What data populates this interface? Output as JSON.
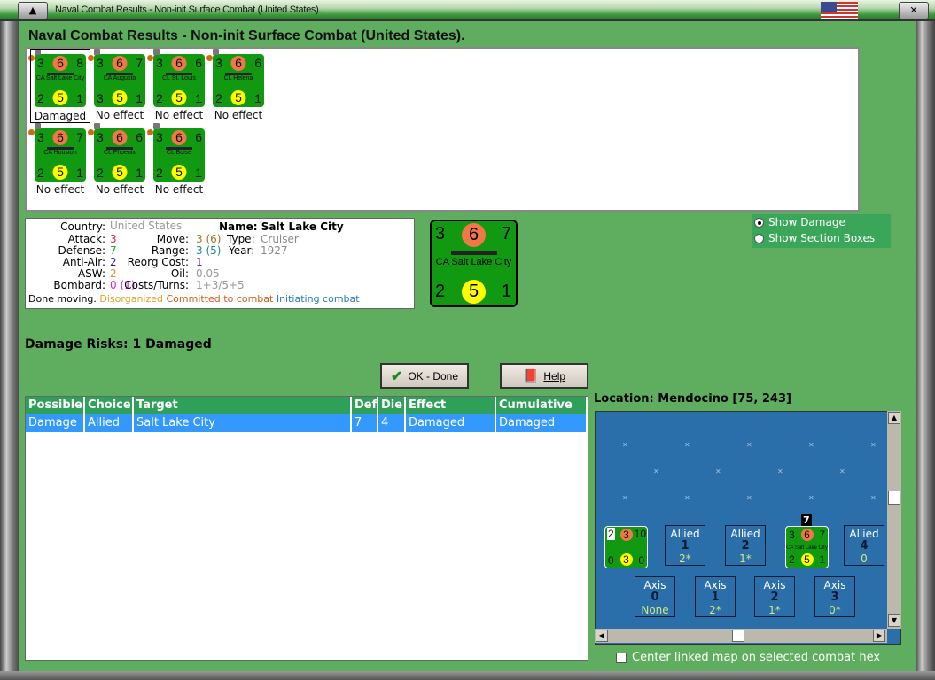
{
  "window": {
    "title": "Naval Combat Results - Non-init Surface Combat (United States).",
    "heading": "Naval Combat Results - Non-init Surface Combat (United States)."
  },
  "units": [
    {
      "name": "CA Salt Lake City",
      "att": "3",
      "mid": "6",
      "def": "8",
      "aa": "2",
      "move": "5",
      "range": "1",
      "result": "Damaged",
      "selected": true
    },
    {
      "name": "CA Augusta",
      "att": "3",
      "mid": "6",
      "def": "7",
      "aa": "3",
      "move": "5",
      "range": "1",
      "result": "No effect"
    },
    {
      "name": "CL St. Louis",
      "att": "3",
      "mid": "6",
      "def": "6",
      "aa": "2",
      "move": "5",
      "range": "1",
      "result": "No effect"
    },
    {
      "name": "CL Helena",
      "att": "3",
      "mid": "6",
      "def": "6",
      "aa": "2",
      "move": "5",
      "range": "1",
      "result": "No effect"
    },
    {
      "name": "CA Houston",
      "att": "3",
      "mid": "6",
      "def": "7",
      "aa": "2",
      "move": "5",
      "range": "1",
      "result": "No effect"
    },
    {
      "name": "CL Phoenix",
      "att": "3",
      "mid": "6",
      "def": "6",
      "aa": "2",
      "move": "5",
      "range": "1",
      "result": "No effect"
    },
    {
      "name": "CL Boise",
      "att": "3",
      "mid": "6",
      "def": "6",
      "aa": "2",
      "move": "5",
      "range": "1",
      "result": "No effect"
    }
  ],
  "info": {
    "country_label": "Country:",
    "country": "United States",
    "name_label": "Name: Salt Lake City",
    "attack_label": "Attack:",
    "attack": "3",
    "defense_label": "Defense:",
    "defense": "7",
    "aa_label": "Anti-Air:",
    "aa": "2",
    "asw_label": "ASW:",
    "asw": "2",
    "bombard_label": "Bombard:",
    "bombard": "0 (1)",
    "move_label": "Move:",
    "move": "3 (6)",
    "range_label": "Range:",
    "range": "3 (5)",
    "reorg_label": "Reorg Cost:",
    "reorg": "1",
    "oil_label": "Oil:",
    "oil": "0.05",
    "costs_label": "Costs/Turns:",
    "costs": "1+3/5+5",
    "type_label": "Type:",
    "type": "Cruiser",
    "year_label": "Year:",
    "year": "1927",
    "status1": "Done moving.",
    "status2": "Disorganized",
    "status3": "Committed to combat",
    "status4": "Initiating combat"
  },
  "bigcard": {
    "att": "3",
    "mid": "6",
    "def": "7",
    "name": "CA Salt Lake City",
    "aa": "2",
    "move": "5",
    "range": "1"
  },
  "options": {
    "show_damage": "Show Damage",
    "show_sections": "Show Section Boxes",
    "selected": "show_damage"
  },
  "risk": "Damage Risks:  1 Damaged",
  "buttons": {
    "ok": "OK - Done",
    "help": "Help"
  },
  "table": {
    "headers": [
      "Possible",
      "Choice",
      "Target",
      "Def",
      "Die",
      "Effect",
      "Cumulative"
    ],
    "rows": [
      [
        "Damage",
        "Allied",
        "Salt Lake City",
        "7",
        "4",
        "Damaged",
        "Damaged"
      ]
    ]
  },
  "location": "Location:  Mendocino [75, 243]",
  "map": {
    "stack": {
      "att": "2",
      "mid": "3",
      "def": "10",
      "aa": "0",
      "move": "3",
      "range": "0"
    },
    "mapunit": {
      "att": "3",
      "mid": "6",
      "def": "7",
      "name": "CA Salt Lake City",
      "aa": "2",
      "move": "5",
      "range": "1",
      "count": "7"
    },
    "allied": [
      {
        "label": "Allied",
        "num": "1",
        "val": "2*"
      },
      {
        "label": "Allied",
        "num": "2",
        "val": "1*"
      },
      {
        "label": "Allied",
        "num": "4",
        "val": "0"
      }
    ],
    "axis": [
      {
        "label": "Axis",
        "num": "0",
        "val": "None"
      },
      {
        "label": "Axis",
        "num": "1",
        "val": "2*"
      },
      {
        "label": "Axis",
        "num": "2",
        "val": "1*"
      },
      {
        "label": "Axis",
        "num": "3",
        "val": "0*"
      }
    ]
  },
  "center_label": "Center linked map on selected combat hex"
}
